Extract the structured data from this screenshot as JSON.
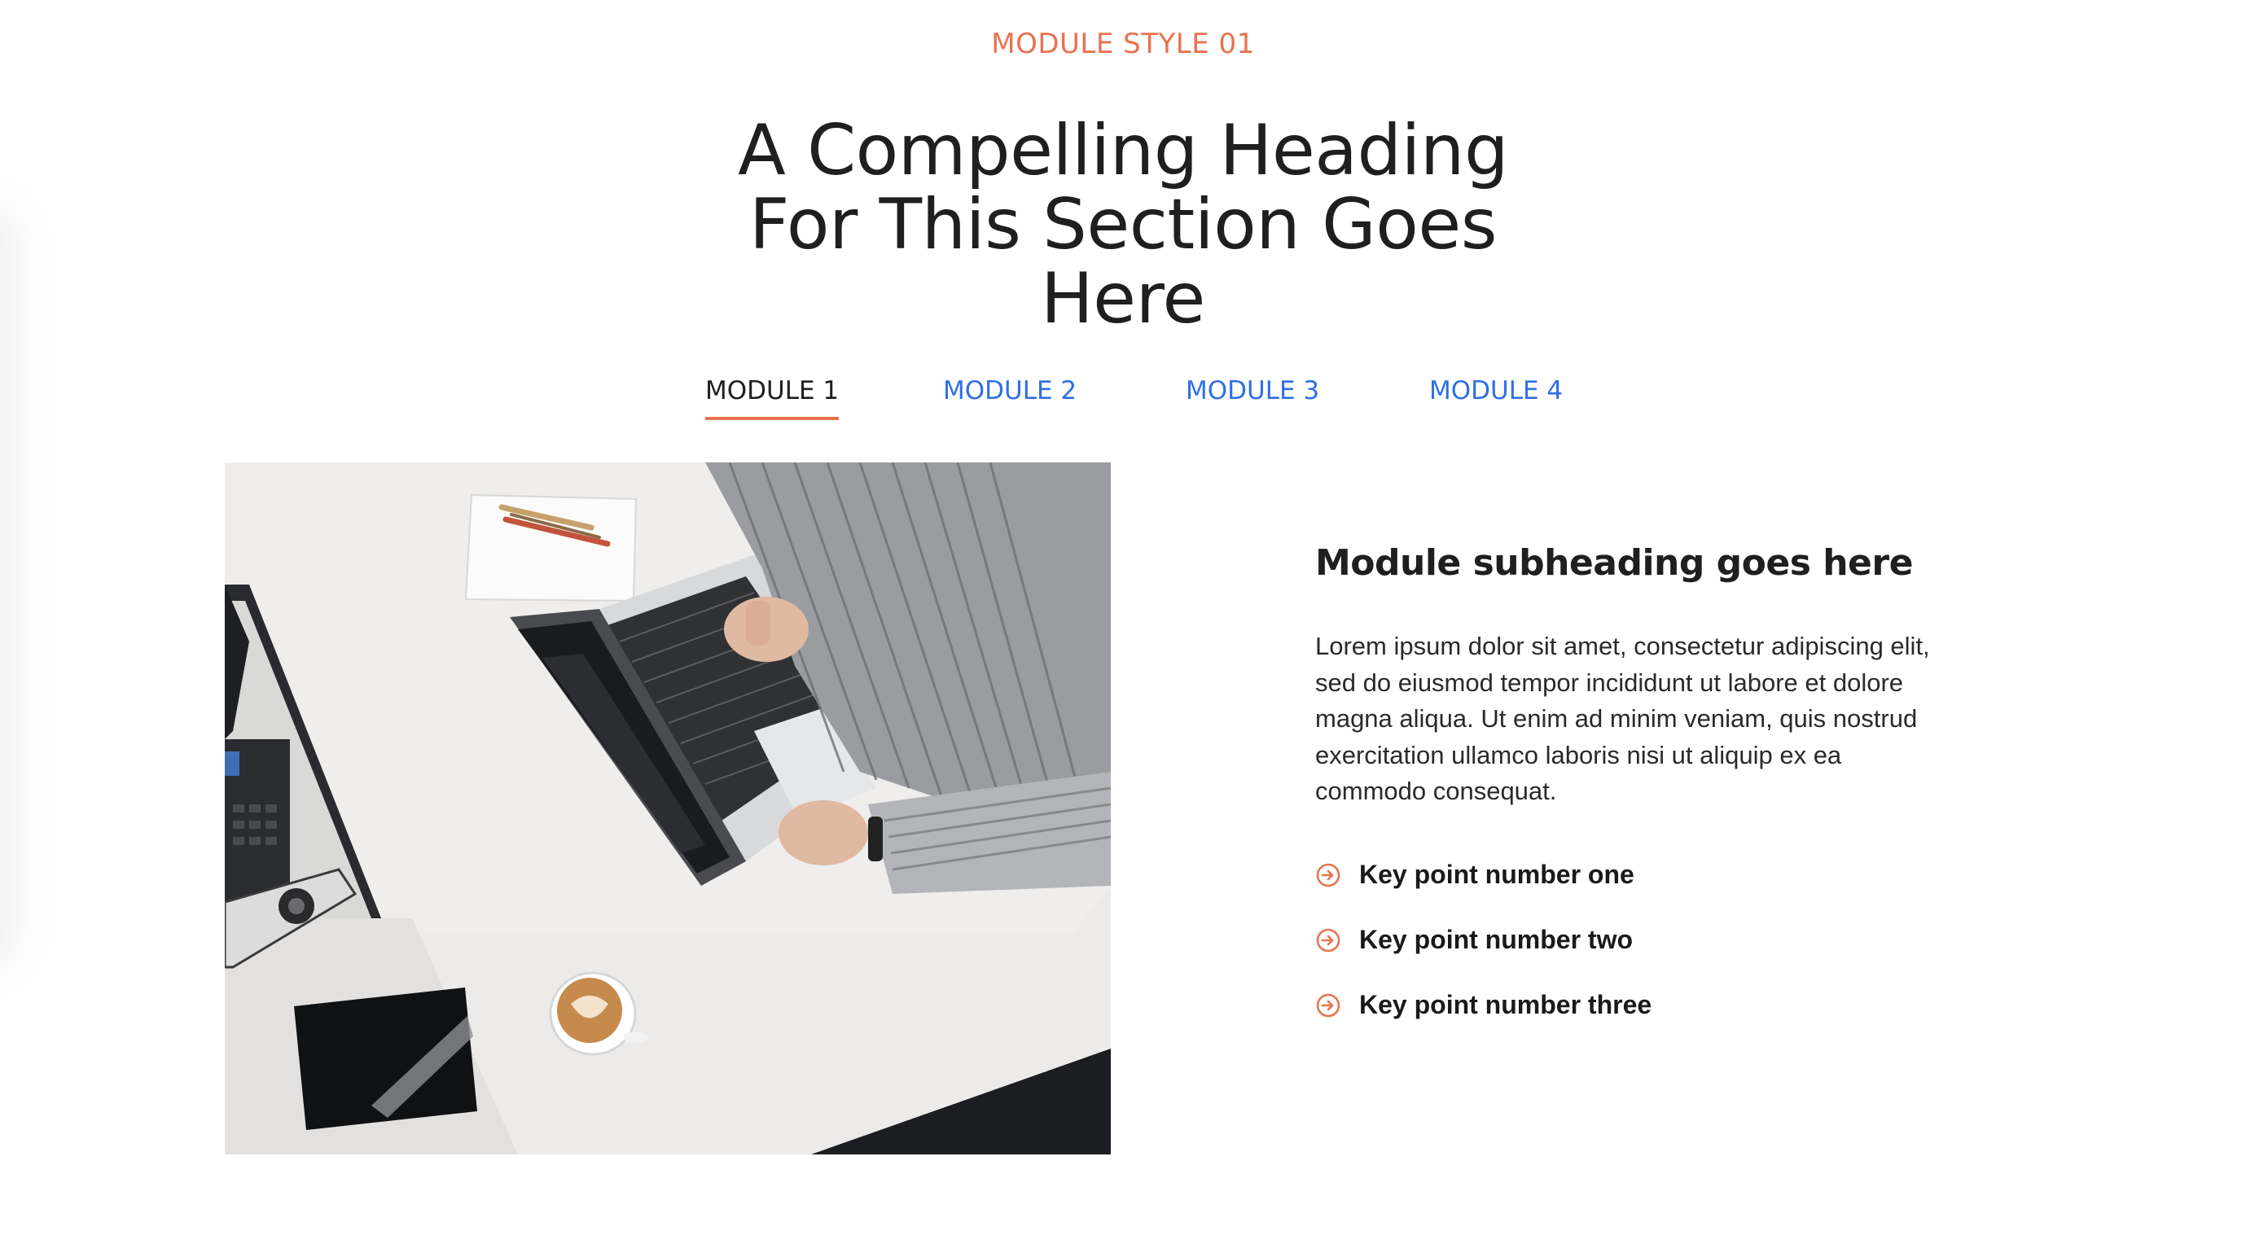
{
  "eyebrow": "MODULE STYLE 01",
  "heading": {
    "line1": "A Compelling Heading",
    "line2": "For This Section Goes",
    "line3": "Here"
  },
  "tabs": [
    {
      "label": "MODULE 1",
      "active": true
    },
    {
      "label": "MODULE 2",
      "active": false
    },
    {
      "label": "MODULE 3",
      "active": false
    },
    {
      "label": "MODULE 4",
      "active": false
    }
  ],
  "module": {
    "subheading": "Module subheading goes here",
    "body": "Lorem ipsum dolor sit amet, consectetur adipiscing elit, sed do eiusmod tempor incididunt ut labore et dolore magna aliqua. Ut enim ad minim veniam, quis nostrud exercitation ullamco laboris nisi ut aliquip ex ea commodo consequat.",
    "points": [
      {
        "label": "Key point number one",
        "icon": "arrow-circle-right-icon"
      },
      {
        "label": "Key point number two",
        "icon": "arrow-circle-right-icon"
      },
      {
        "label": "Key point number three",
        "icon": "arrow-circle-right-icon"
      }
    ]
  },
  "colors": {
    "accent": "#E8734F",
    "link": "#2F6FE5",
    "text": "#1f1f1f"
  }
}
